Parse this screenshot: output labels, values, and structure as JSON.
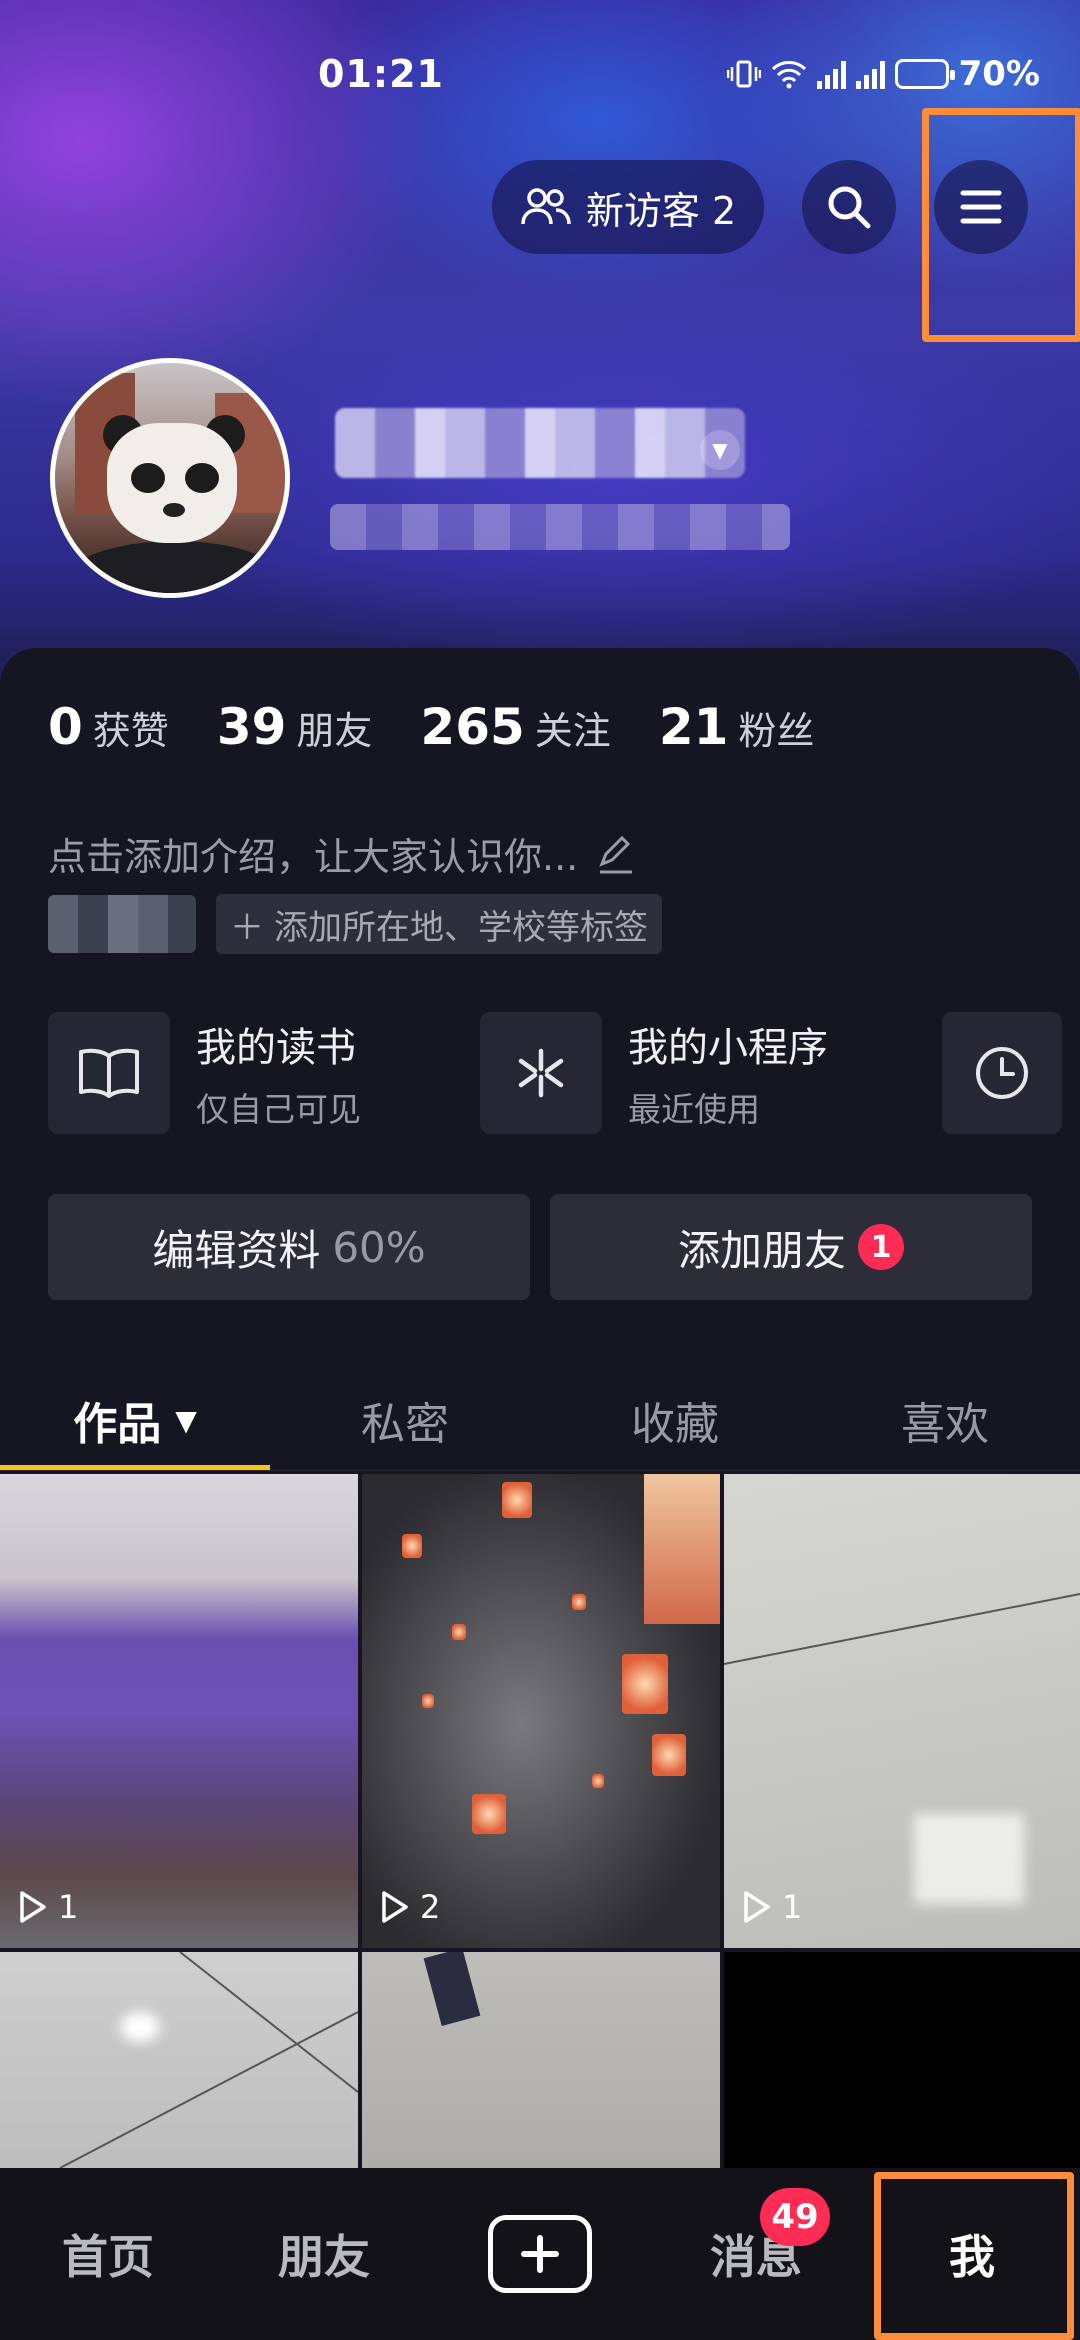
{
  "status_bar": {
    "time": "01:21",
    "battery": "70%"
  },
  "header": {
    "visitor_label": "新访客 2"
  },
  "profile": {
    "stats": [
      {
        "num": "0",
        "label": "获赞"
      },
      {
        "num": "39",
        "label": "朋友"
      },
      {
        "num": "265",
        "label": "关注"
      },
      {
        "num": "21",
        "label": "粉丝"
      }
    ],
    "bio": "点击添加介绍，让大家认识你...",
    "add_tag": "添加所在地、学校等标签"
  },
  "features": [
    {
      "title": "我的读书",
      "sub": "仅自己可见"
    },
    {
      "title": "我的小程序",
      "sub": "最近使用"
    }
  ],
  "actions": {
    "edit_label": "编辑资料",
    "edit_progress": "60%",
    "add_friend_label": "添加朋友",
    "add_friend_badge": "1"
  },
  "tabs": [
    "作品",
    "私密",
    "收藏",
    "喜欢"
  ],
  "videos": [
    {
      "plays": "1"
    },
    {
      "plays": "2"
    },
    {
      "plays": "1"
    }
  ],
  "bottom_nav": {
    "home": "首页",
    "friends": "朋友",
    "messages": "消息",
    "messages_badge": "49",
    "me": "我"
  },
  "colors": {
    "accent_yellow": "#f5c518",
    "badge_red": "#fe2c55",
    "highlight_orange": "#ff8c3a"
  }
}
